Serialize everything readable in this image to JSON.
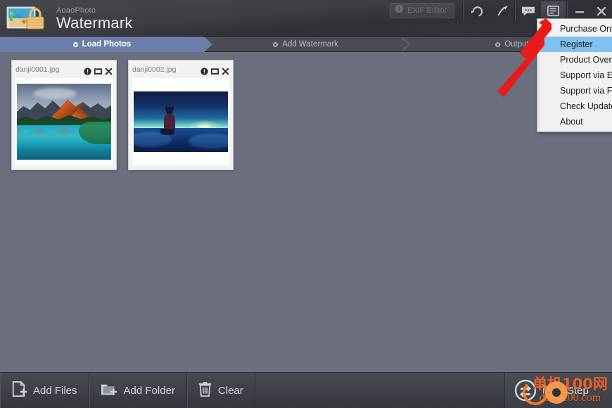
{
  "window": {
    "brand_sub": "AoaoPhoto",
    "brand_main": "Watermark",
    "logo_icon": "photo-padlock-logo-icon"
  },
  "titlebar": {
    "exif_button": {
      "label": "EXIF Editor",
      "icon": "exclamation-circle-icon",
      "disabled": true
    },
    "buttons": [
      {
        "name": "undo-button",
        "icon": "undo-arrow-icon"
      },
      {
        "name": "redo-button",
        "icon": "redo-arrow-icon"
      },
      {
        "name": "feedback-button",
        "icon": "speech-bubble-icon"
      },
      {
        "name": "menu-button",
        "icon": "menu-list-icon",
        "active": true
      }
    ],
    "minimize_icon": "minimize-icon",
    "close_icon": "close-x-icon"
  },
  "menu": {
    "items": [
      {
        "label": "Purchase Online",
        "selected": false
      },
      {
        "label": "Register",
        "selected": true
      },
      {
        "label": "Product Overview",
        "selected": false
      },
      {
        "label": "Support via E-mail",
        "selected": false
      },
      {
        "label": "Support via Forum",
        "selected": false
      },
      {
        "label": "Check Update",
        "selected": false
      },
      {
        "label": "About",
        "selected": false
      }
    ],
    "highlight_color": "#7fc1ef"
  },
  "steps": [
    {
      "label": "Load Photos",
      "active": true,
      "dot_icon": "step-dot-icon"
    },
    {
      "label": "Add Watermark",
      "active": false,
      "dot_icon": "step-dot-icon"
    },
    {
      "label": "Output",
      "active": false,
      "dot_icon": "step-dot-icon"
    }
  ],
  "step_accent": "#6c7fab",
  "thumbnails": [
    {
      "filename": "danji0001.jpg",
      "icons": [
        "info-circle-icon",
        "preview-square-icon",
        "remove-x-icon"
      ],
      "image": "mountain-lake-photo"
    },
    {
      "filename": "danji0002.jpg",
      "icons": [
        "info-circle-icon",
        "preview-square-icon",
        "remove-x-icon"
      ],
      "image": "anime-night-sea-photo"
    }
  ],
  "bottombar": {
    "add_files": {
      "label": "Add Files",
      "icon": "file-plus-icon"
    },
    "add_folder": {
      "label": "Add Folder",
      "icon": "folder-plus-icon"
    },
    "clear": {
      "label": "Clear",
      "icon": "trash-can-icon"
    },
    "next_step": {
      "label": "Next Step",
      "icon": "next-step-arrows-icon"
    }
  },
  "watermark_overlay": {
    "chinese": "单机100网",
    "site": "danji100.com",
    "color": "#e8632a"
  },
  "annotations": {
    "arrow_color": "#e81a1a",
    "arrows": [
      {
        "name": "arrow-to-menu-button",
        "points_at": "menu-button"
      },
      {
        "name": "arrow-to-register-item",
        "points_at": "menu-item-register"
      }
    ]
  }
}
